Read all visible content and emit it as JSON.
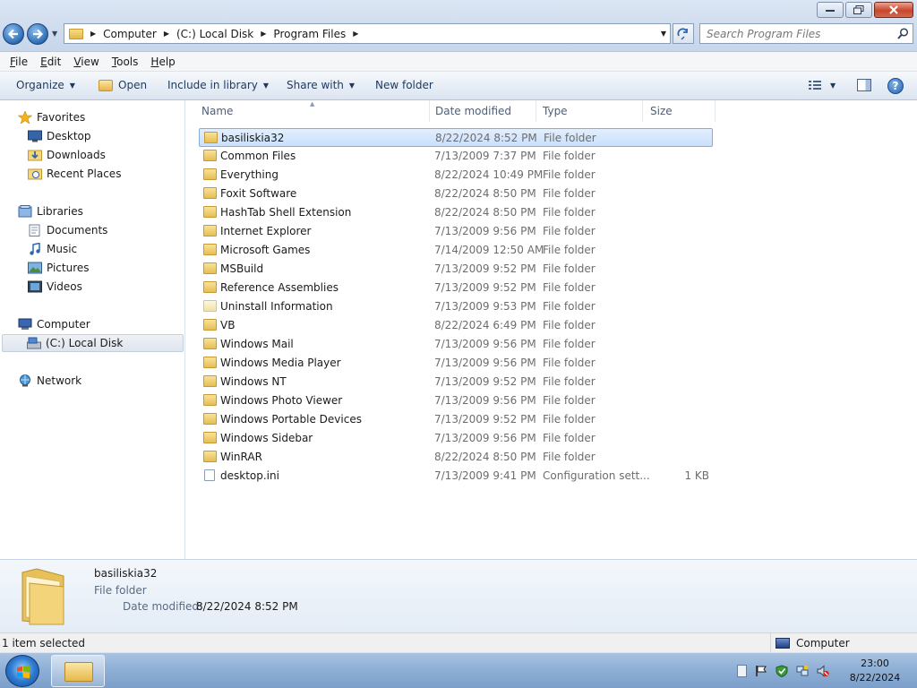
{
  "window": {
    "minimize_label": "▭",
    "maximize_label": "❐",
    "close_label": "✕"
  },
  "address": {
    "breadcrumbs": [
      "Computer",
      "(C:) Local Disk",
      "Program Files"
    ],
    "search_placeholder": "Search Program Files"
  },
  "menu": {
    "items": [
      {
        "key": "F",
        "rest": "ile"
      },
      {
        "key": "E",
        "rest": "dit"
      },
      {
        "key": "V",
        "rest": "iew"
      },
      {
        "key": "T",
        "rest": "ools"
      },
      {
        "key": "H",
        "rest": "elp"
      }
    ]
  },
  "toolbar": {
    "organize": "Organize",
    "open": "Open",
    "include": "Include in library",
    "share": "Share with",
    "new_folder": "New folder"
  },
  "nav": {
    "favorites": "Favorites",
    "desktop": "Desktop",
    "downloads": "Downloads",
    "recent": "Recent Places",
    "libraries": "Libraries",
    "documents": "Documents",
    "music": "Music",
    "pictures": "Pictures",
    "videos": "Videos",
    "computer": "Computer",
    "local_disk": "(C:) Local Disk",
    "network": "Network"
  },
  "columns": {
    "name": "Name",
    "date": "Date modified",
    "type": "Type",
    "size": "Size"
  },
  "files": [
    {
      "name": "basiliskia32",
      "date": "8/22/2024 8:52 PM",
      "type": "File folder",
      "size": "",
      "icon": "folder-icon",
      "selected": true
    },
    {
      "name": "Common Files",
      "date": "7/13/2009 7:37 PM",
      "type": "File folder",
      "size": "",
      "icon": "folder-icon"
    },
    {
      "name": "Everything",
      "date": "8/22/2024 10:49 PM",
      "type": "File folder",
      "size": "",
      "icon": "folder-icon"
    },
    {
      "name": "Foxit Software",
      "date": "8/22/2024 8:50 PM",
      "type": "File folder",
      "size": "",
      "icon": "folder-icon"
    },
    {
      "name": "HashTab Shell Extension",
      "date": "8/22/2024 8:50 PM",
      "type": "File folder",
      "size": "",
      "icon": "folder-icon"
    },
    {
      "name": "Internet Explorer",
      "date": "7/13/2009 9:56 PM",
      "type": "File folder",
      "size": "",
      "icon": "folder-icon"
    },
    {
      "name": "Microsoft Games",
      "date": "7/14/2009 12:50 AM",
      "type": "File folder",
      "size": "",
      "icon": "folder-icon"
    },
    {
      "name": "MSBuild",
      "date": "7/13/2009 9:52 PM",
      "type": "File folder",
      "size": "",
      "icon": "folder-icon"
    },
    {
      "name": "Reference Assemblies",
      "date": "7/13/2009 9:52 PM",
      "type": "File folder",
      "size": "",
      "icon": "folder-icon"
    },
    {
      "name": "Uninstall Information",
      "date": "7/13/2009 9:53 PM",
      "type": "File folder",
      "size": "",
      "icon": "folder-icon",
      "light": true
    },
    {
      "name": "VB",
      "date": "8/22/2024 6:49 PM",
      "type": "File folder",
      "size": "",
      "icon": "folder-icon"
    },
    {
      "name": "Windows Mail",
      "date": "7/13/2009 9:56 PM",
      "type": "File folder",
      "size": "",
      "icon": "folder-icon"
    },
    {
      "name": "Windows Media Player",
      "date": "7/13/2009 9:56 PM",
      "type": "File folder",
      "size": "",
      "icon": "folder-icon"
    },
    {
      "name": "Windows NT",
      "date": "7/13/2009 9:52 PM",
      "type": "File folder",
      "size": "",
      "icon": "folder-icon"
    },
    {
      "name": "Windows Photo Viewer",
      "date": "7/13/2009 9:56 PM",
      "type": "File folder",
      "size": "",
      "icon": "folder-icon"
    },
    {
      "name": "Windows Portable Devices",
      "date": "7/13/2009 9:52 PM",
      "type": "File folder",
      "size": "",
      "icon": "folder-icon"
    },
    {
      "name": "Windows Sidebar",
      "date": "7/13/2009 9:56 PM",
      "type": "File folder",
      "size": "",
      "icon": "folder-icon"
    },
    {
      "name": "WinRAR",
      "date": "8/22/2024 8:50 PM",
      "type": "File folder",
      "size": "",
      "icon": "folder-icon"
    },
    {
      "name": "desktop.ini",
      "date": "7/13/2009 9:41 PM",
      "type": "Configuration sett...",
      "size": "1 KB",
      "icon": "config-file-icon"
    }
  ],
  "details": {
    "name": "basiliskia32",
    "type": "File folder",
    "modified_label": "Date modified:",
    "modified_value": "8/22/2024 8:52 PM"
  },
  "status": {
    "left": "1 item selected",
    "right": "Computer"
  },
  "taskbar": {
    "time": "23:00",
    "date": "8/22/2024"
  },
  "colors": {
    "selection": "#cce4fb",
    "accent": "#1e395b"
  }
}
